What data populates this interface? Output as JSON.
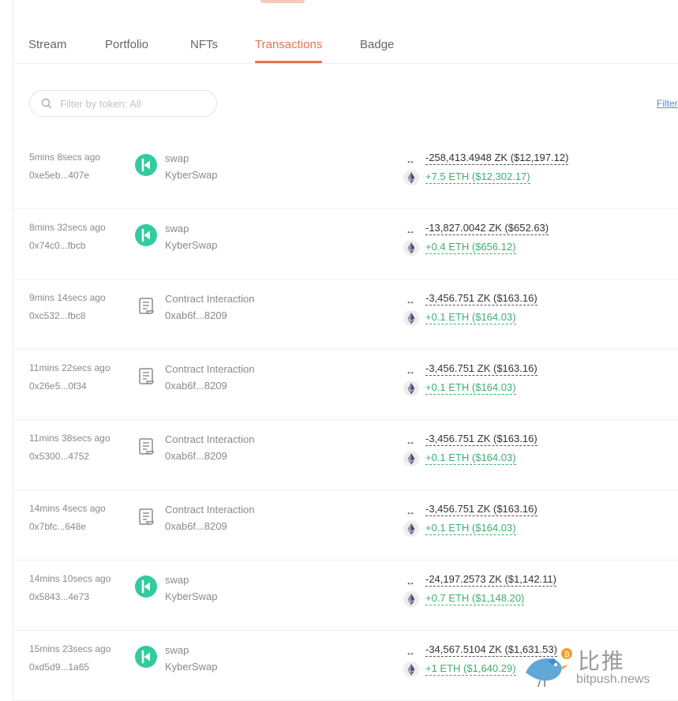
{
  "tabs": [
    {
      "label": "Stream"
    },
    {
      "label": "Portfolio"
    },
    {
      "label": "NFTs"
    },
    {
      "label": "Transactions"
    },
    {
      "label": "Badge"
    }
  ],
  "active_tab": "Transactions",
  "filter": {
    "placeholder": "Filter by token: All",
    "link_label": "Filter"
  },
  "accent_color": "#e5734f",
  "positive_color": "#3fae72",
  "transactions": [
    {
      "time": "5mins 8secs ago",
      "hash": "0xe5eb...407e",
      "icon": "kyberswap-logo-icon",
      "action": "swap",
      "sub": "KyberSwap",
      "out": "-258,413.4948 ZK ($12,197.12)",
      "in": "+7.5 ETH ($12,302.17)"
    },
    {
      "time": "8mins 32secs ago",
      "hash": "0x74c0...fbcb",
      "icon": "kyberswap-logo-icon",
      "action": "swap",
      "sub": "KyberSwap",
      "out": "-13,827.0042 ZK ($652.63)",
      "in": "+0.4 ETH ($656.12)"
    },
    {
      "time": "9mins 14secs ago",
      "hash": "0xc532...fbc8",
      "icon": "contract-scroll-icon",
      "action": "Contract Interaction",
      "sub": "0xab6f...8209",
      "out": "-3,456.751 ZK ($163.16)",
      "in": "+0.1 ETH ($164.03)"
    },
    {
      "time": "11mins 22secs ago",
      "hash": "0x26e5...0f34",
      "icon": "contract-scroll-icon",
      "action": "Contract Interaction",
      "sub": "0xab6f...8209",
      "out": "-3,456.751 ZK ($163.16)",
      "in": "+0.1 ETH ($164.03)"
    },
    {
      "time": "11mins 38secs ago",
      "hash": "0x5300...4752",
      "icon": "contract-scroll-icon",
      "action": "Contract Interaction",
      "sub": "0xab6f...8209",
      "out": "-3,456.751 ZK ($163.16)",
      "in": "+0.1 ETH ($164.03)"
    },
    {
      "time": "14mins 4secs ago",
      "hash": "0x7bfc...648e",
      "icon": "contract-scroll-icon",
      "action": "Contract Interaction",
      "sub": "0xab6f...8209",
      "out": "-3,456.751 ZK ($163.16)",
      "in": "+0.1 ETH ($164.03)"
    },
    {
      "time": "14mins 10secs ago",
      "hash": "0x5843...4e73",
      "icon": "kyberswap-logo-icon",
      "action": "swap",
      "sub": "KyberSwap",
      "out": "-24,197.2573 ZK ($1,142.11)",
      "in": "+0.7 ETH ($1,148.20)"
    },
    {
      "time": "15mins 23secs ago",
      "hash": "0xd5d9...1a65",
      "icon": "kyberswap-logo-icon",
      "action": "swap",
      "sub": "KyberSwap",
      "out": "-34,567.5104 ZK ($1,631.53)",
      "in": "+1 ETH ($1,640.29)"
    }
  ],
  "watermark": {
    "cn": "比推",
    "en": "bitpush.news"
  }
}
